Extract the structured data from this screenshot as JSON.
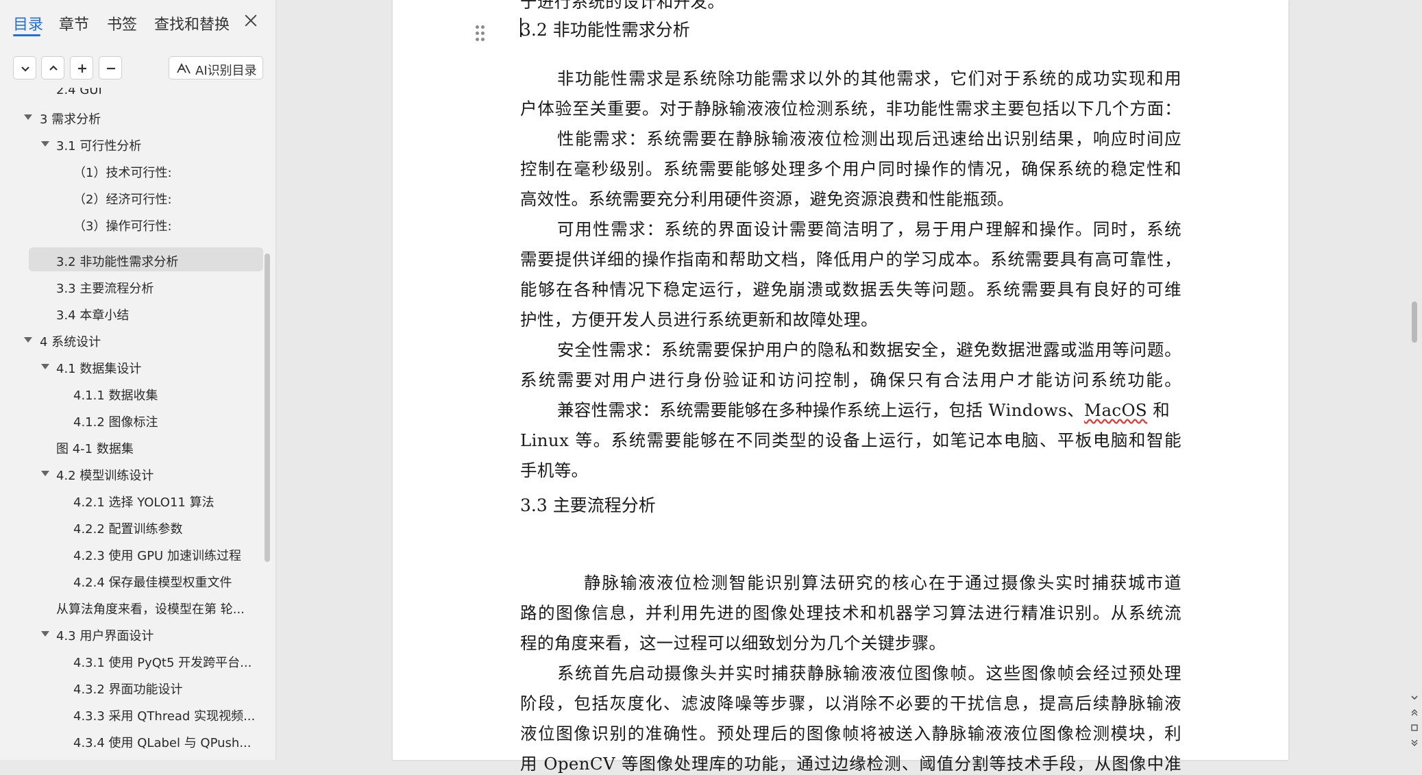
{
  "nav": {
    "tabs": [
      {
        "label": "目录"
      },
      {
        "label": "章节"
      },
      {
        "label": "书签"
      },
      {
        "label": "查找和替换"
      }
    ],
    "ai_button_label": "AI识别目录",
    "toc": [
      {
        "label": "2.4 GUI"
      },
      {
        "label": "3  需求分析"
      },
      {
        "label": "3.1 可行性分析"
      },
      {
        "label": "（1）技术可行性:"
      },
      {
        "label": "（2）经济可行性:"
      },
      {
        "label": "（3）操作可行性:"
      },
      {
        "label": "3.2  非功能性需求分析"
      },
      {
        "label": "3.3 主要流程分析"
      },
      {
        "label": "3.4 本章小结"
      },
      {
        "label": "4  系统设计"
      },
      {
        "label": "4.1  数据集设计"
      },
      {
        "label": "4.1.1 数据收集"
      },
      {
        "label": "4.1.2 图像标注"
      },
      {
        "label": "图 4-1  数据集"
      },
      {
        "label": "4.2  模型训练设计"
      },
      {
        "label": "4.2.1  选择  YOLO11  算法"
      },
      {
        "label": "4.2.2  配置训练参数"
      },
      {
        "label": "4.2.3  使用  GPU  加速训练过程"
      },
      {
        "label": "4.2.4  保存最佳模型权重文件"
      },
      {
        "label": "从算法角度来看，设模型在第  轮..."
      },
      {
        "label": "4.3 用户界面设计"
      },
      {
        "label": "4.3.1  使用  PyQt5  开发跨平台..."
      },
      {
        "label": "4.3.2  界面功能设计"
      },
      {
        "label": "4.3.3  采用  QThread  实现视频..."
      },
      {
        "label": "4.3.4  使用  QLabel  与  QPush..."
      }
    ]
  },
  "document": {
    "top_partial": "于进行系统的设计和开发。",
    "heading_32": "3.2  非功能性需求分析",
    "heading_33": "3.3 主要流程分析",
    "p1_l1": "非功能性需求是系统除功能需求以外的其他需求，它们对于系统的成功实现和用",
    "p1_l2": "户体验至关重要。对于静脉输液液位检测系统，非功能性需求主要包括以下几个方面：",
    "p2_l1": "性能需求：系统需要在静脉输液液位检测出现后迅速给出识别结果，响应时间应",
    "p2_l2": "控制在毫秒级别。系统需要能够处理多个用户同时操作的情况，确保系统的稳定性和",
    "p2_l3": "高效性。系统需要充分利用硬件资源，避免资源浪费和性能瓶颈。",
    "p3_l1": "可用性需求：系统的界面设计需要简洁明了，易于用户理解和操作。同时，系统",
    "p3_l2": "需要提供详细的操作指南和帮助文档，降低用户的学习成本。系统需要具有高可靠性，",
    "p3_l3": "能够在各种情况下稳定运行，避免崩溃或数据丢失等问题。系统需要具有良好的可维",
    "p3_l4": "护性，方便开发人员进行系统更新和故障处理。",
    "p4_l1": "安全性需求：系统需要保护用户的隐私和数据安全，避免数据泄露或滥用等问题。",
    "p4_l2": "系统需要对用户进行身份验证和访问控制，确保只有合法用户才能访问系统功能。",
    "p5_l1a": "兼容性需求：系统需要能够在多种操作系统上运行，包括 Windows、",
    "p5_l1b": "MacOS",
    "p5_l1c": " 和",
    "p5_l2": "Linux 等。系统需要能够在不同类型的设备上运行，如笔记本电脑、平板电脑和智能",
    "p5_l3": "手机等。",
    "p6_l1": "静脉输液液位检测智能识别算法研究的核心在于通过摄像头实时捕获城市道",
    "p6_l2": "路的图像信息，并利用先进的图像处理技术和机器学习算法进行精准识别。从系统流",
    "p6_l3": "程的角度来看，这一过程可以细致划分为几个关键步骤。",
    "p7_l1": "系统首先启动摄像头并实时捕获静脉输液液位图像帧。这些图像帧会经过预处理",
    "p7_l2": "阶段，包括灰度化、滤波降噪等步骤，以消除不必要的干扰信息，提高后续静脉输液",
    "p7_l3": "液位图像识别的准确性。预处理后的图像帧将被送入静脉输液液位图像检测模块，利",
    "p7_l4": "用 OpenCV 等图像处理库的功能，通过边缘检测、阈值分割等技术手段，从图像中准"
  },
  "colors": {
    "accent": "#1f6fe0",
    "selected_bg": "#dedede",
    "spell_error": "#d94040"
  }
}
